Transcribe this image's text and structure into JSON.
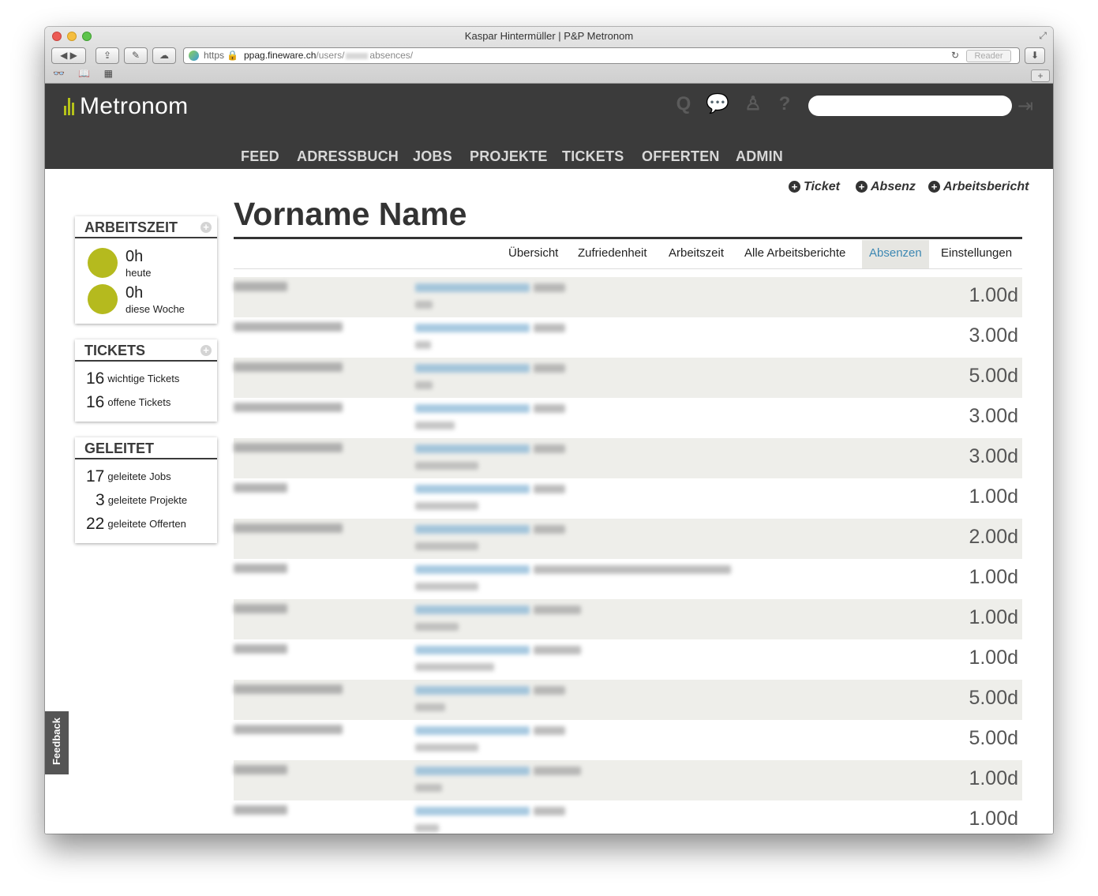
{
  "browser": {
    "window_title": "Kaspar Hintermüller | P&P Metronom",
    "url_scheme": "https",
    "url_host": "ppag.fineware.ch",
    "url_path_start": "/users/",
    "url_path_end": "absences/",
    "reader_label": "Reader",
    "new_tab_label": "+"
  },
  "header": {
    "logo": "Metronom",
    "nav": [
      "FEED",
      "ADRESSBUCH",
      "JOBS",
      "PROJEKTE",
      "TICKETS",
      "OFFERTEN",
      "ADMIN"
    ]
  },
  "actions": {
    "ticket": "Ticket",
    "absenz": "Absenz",
    "arbeitsbericht": "Arbeitsbericht"
  },
  "page_title": "Vorname Name",
  "tabs": [
    {
      "label": "Übersicht",
      "active": false
    },
    {
      "label": "Zufriedenheit",
      "active": false
    },
    {
      "label": "Arbeitszeit",
      "active": false
    },
    {
      "label": "Alle Arbeitsberichte",
      "active": false
    },
    {
      "label": "Absenzen",
      "active": true
    },
    {
      "label": "Einstellungen",
      "active": false
    }
  ],
  "widgets": {
    "arbeitszeit": {
      "title": "ARBEITSZEIT",
      "today_value": "0h",
      "today_label": "heute",
      "week_value": "0h",
      "week_label": "diese Woche"
    },
    "tickets": {
      "title": "TICKETS",
      "important_count": "16",
      "important_label": "wichtige Tickets",
      "open_count": "16",
      "open_label": "offene Tickets"
    },
    "geleitet": {
      "title": "GELEITET",
      "jobs_count": "17",
      "jobs_label": "geleitete Jobs",
      "projects_count": "3",
      "projects_label": "geleitete Projekte",
      "offers_count": "22",
      "offers_label": "geleitete Offerten"
    }
  },
  "absences": [
    {
      "duration": "1.00d"
    },
    {
      "duration": "3.00d"
    },
    {
      "duration": "5.00d"
    },
    {
      "duration": "3.00d"
    },
    {
      "duration": "3.00d"
    },
    {
      "duration": "1.00d"
    },
    {
      "duration": "2.00d"
    },
    {
      "duration": "1.00d"
    },
    {
      "duration": "1.00d"
    },
    {
      "duration": "1.00d"
    },
    {
      "duration": "5.00d"
    },
    {
      "duration": "5.00d"
    },
    {
      "duration": "1.00d"
    },
    {
      "duration": "1.00d"
    }
  ],
  "feedback_label": "Feedback",
  "colors": {
    "topbar": "#3b3b3b",
    "accent_green": "#b5ba1e",
    "active_tab_text": "#3d88b3",
    "row_shade": "#eeeeea"
  }
}
